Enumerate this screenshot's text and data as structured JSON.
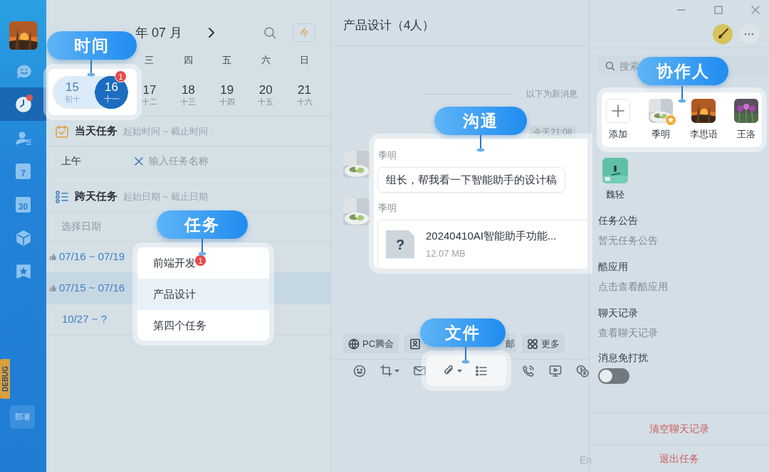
{
  "nav": {
    "items": [
      {
        "kind": "chat",
        "selected": false,
        "dot": false
      },
      {
        "kind": "clock",
        "selected": true,
        "dot": true
      },
      {
        "kind": "contacts",
        "selected": false,
        "dot": false
      },
      {
        "kind": "calendar",
        "label": "7",
        "selected": false,
        "dot": false
      },
      {
        "kind": "calendar",
        "label": "30",
        "selected": false,
        "dot": false
      },
      {
        "kind": "cube",
        "selected": false,
        "dot": false
      },
      {
        "kind": "star",
        "selected": false,
        "dot": false
      }
    ],
    "debug_tag": "DEBUG",
    "deploy_button": "部署"
  },
  "calendar": {
    "month": "年 07 月",
    "today_button": "今",
    "weekdays": [
      "三",
      "四",
      "五",
      "六",
      "日"
    ],
    "days": [
      {
        "day": "17",
        "lunar": "十二",
        "selected": false,
        "in_range": false
      },
      {
        "day": "18",
        "lunar": "十三",
        "selected": false,
        "in_range": false
      },
      {
        "day": "19",
        "lunar": "十四",
        "selected": false,
        "in_range": false
      },
      {
        "day": "20",
        "lunar": "十五",
        "selected": false,
        "in_range": false
      },
      {
        "day": "21",
        "lunar": "十六",
        "selected": false,
        "in_range": false
      }
    ]
  },
  "day_tasks": {
    "title": "当天任务",
    "hint": "起始时间 ~ 截止时间",
    "period": "上午",
    "placeholder": "输入任务名称"
  },
  "multi_day_tasks": {
    "title": "跨天任务",
    "hint": "起始日期 ~ 截止日期",
    "column_1": "选择日期",
    "rows": [
      {
        "dates": "07/16 ~ 07/19",
        "liked": true,
        "selected": false
      },
      {
        "dates": "07/15 ~ 07/16",
        "liked": true,
        "selected": true
      },
      {
        "dates": "10/27 ~ ?",
        "liked": false,
        "selected": false
      }
    ]
  },
  "chat": {
    "title": "产品设计（4人）",
    "new_messages": "以下为新消息",
    "time": "今天21:08",
    "quick_actions": [
      {
        "kind": "globe",
        "label": "PC腾会"
      },
      {
        "kind": "contact-card"
      },
      {
        "kind": "mail",
        "label": "邮"
      },
      {
        "kind": "apps",
        "label": "更多"
      }
    ],
    "toolbar": [
      {
        "kind": "emoji"
      },
      {
        "kind": "crop"
      },
      {
        "kind": "mail"
      },
      {
        "kind": "gap"
      },
      {
        "kind": "phone"
      },
      {
        "kind": "screen"
      },
      {
        "kind": "number"
      }
    ],
    "input_mode": "En"
  },
  "panel": {
    "search_placeholder": "搜索",
    "members": [
      {
        "name": "魏轻"
      }
    ],
    "sections": [
      {
        "title": "任务公告",
        "value": "暂无任务公告"
      },
      {
        "title": "酷应用",
        "value": "点击查看酷应用"
      },
      {
        "title": "聊天记录",
        "value": "查看聊天记录"
      }
    ],
    "mute": {
      "label": "消息免打扰",
      "on": false
    },
    "actions": [
      "清空聊天记录",
      "退出任务"
    ]
  },
  "callouts": [
    {
      "label": "时间",
      "days": [
        {
          "day": "15",
          "lunar": "初十",
          "selected": false,
          "in_range": true
        },
        {
          "day": "16",
          "lunar": "十一",
          "selected": true,
          "in_range": true,
          "badge": "1"
        }
      ]
    },
    {
      "label": "任务",
      "tasks": [
        {
          "name": "前端开发",
          "badge": "1",
          "selected": false
        },
        {
          "name": "产品设计",
          "selected": true
        },
        {
          "name": "第四个任务",
          "selected": false
        }
      ]
    },
    {
      "label": "沟通",
      "messages": [
        {
          "sender": "季明",
          "kind": "text",
          "text": "组长，帮我看一下智能助手的设计稿"
        },
        {
          "sender": "季明",
          "kind": "file",
          "file_icon": "?",
          "file_name": "20240410AI智能助手功能...",
          "file_size": "12.07 MB"
        }
      ]
    },
    {
      "label": "文件",
      "tools": [
        {
          "kind": "attach"
        },
        {
          "kind": "list"
        }
      ]
    },
    {
      "label": "协作人",
      "members": [
        {
          "kind": "add",
          "name": "添加"
        },
        {
          "kind": "person",
          "name": "季明",
          "owner": true
        },
        {
          "kind": "person",
          "name": "李思语",
          "owner": false
        },
        {
          "kind": "person",
          "name": "王洛",
          "owner": false
        }
      ]
    }
  ]
}
